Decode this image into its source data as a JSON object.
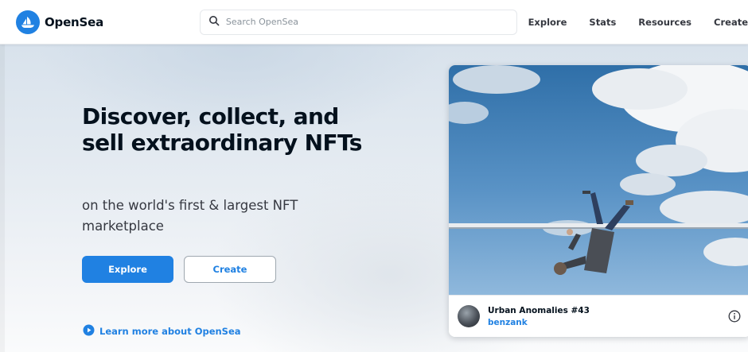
{
  "brand": {
    "name": "OpenSea",
    "logo_icon": "opensea-boat-icon",
    "accent_color": "#2081e2"
  },
  "search": {
    "placeholder": "Search OpenSea",
    "value": "",
    "icon": "search-icon"
  },
  "nav": {
    "items": [
      {
        "label": "Explore"
      },
      {
        "label": "Stats"
      },
      {
        "label": "Resources"
      },
      {
        "label": "Create"
      }
    ]
  },
  "hero": {
    "headline": "Discover, collect, and sell extraordinary NFTs",
    "subheadline": "on the world's first & largest NFT marketplace",
    "primary_button": "Explore",
    "secondary_button": "Create",
    "learn_more": "Learn more about OpenSea",
    "learn_more_icon": "play-circle-icon"
  },
  "featured_card": {
    "title": "Urban Anomalies #43",
    "creator": "benzank",
    "image_icon": "featured-nft-image",
    "info_icon": "info-icon"
  }
}
